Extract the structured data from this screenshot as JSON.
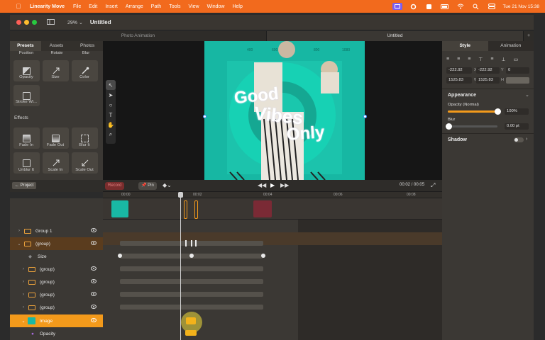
{
  "menubar": {
    "app_name": "Linearity Move",
    "items": [
      "File",
      "Edit",
      "Insert",
      "Arrange",
      "Path",
      "Tools",
      "View",
      "Window",
      "Help"
    ],
    "datetime": "Tue 21 Nov  15:38"
  },
  "window": {
    "zoom": "29%",
    "title": "Untitled",
    "tabs": [
      "Photo Animation",
      "Untitled"
    ]
  },
  "left_panel": {
    "tabs": [
      "Presets",
      "Assets",
      "Photos"
    ],
    "top_row_labels": [
      "Position",
      "Rotate",
      "Blur"
    ],
    "presets": [
      "Opacity",
      "Size",
      "Color",
      "Stroke Wi..."
    ],
    "effects_title": "Effects",
    "effects": [
      "Fade In",
      "Fade Out",
      "Blur It",
      "Unblur It",
      "Scale In",
      "Scale Out"
    ],
    "back_button": "Project"
  },
  "artboard": {
    "ruler_marks": [
      "400",
      "600",
      "800",
      "1080"
    ],
    "headline_lines": [
      "Good",
      "Vibes",
      "Only"
    ]
  },
  "right_panel": {
    "tabs": [
      "Style",
      "Animation"
    ],
    "x": "-222.92",
    "x_label": "X",
    "y": "-222.92",
    "y_label": "Y",
    "rotation": "0",
    "width": "1525.83",
    "width_label": "W",
    "height": "1525.83",
    "height_label": "H",
    "appearance_title": "Appearance",
    "opacity_label": "Opacity (Normal)",
    "opacity_value": "100%",
    "opacity_fraction": 1.0,
    "blur_label": "Blur",
    "blur_value": "0.00 pt",
    "shadow_title": "Shadow"
  },
  "transport": {
    "record_label": "Record",
    "pin_label": "Pin",
    "time": "00:02 / 00:05"
  },
  "ruler": {
    "labels": [
      "00:00",
      "00:02",
      "00:04",
      "00:06",
      "00:08"
    ]
  },
  "layers": [
    {
      "name": "Group 1",
      "expanded": false
    },
    {
      "name": "(group)",
      "expanded": true
    },
    {
      "name": "Size",
      "property": true
    },
    {
      "name": "(group)",
      "expanded": false
    },
    {
      "name": "(group)",
      "expanded": false
    },
    {
      "name": "(group)",
      "expanded": false
    },
    {
      "name": "(group)",
      "expanded": false
    },
    {
      "name": "Image",
      "selected": true
    },
    {
      "name": "Opacity",
      "property": true
    }
  ],
  "colors": {
    "menubar": "#f26a1d",
    "accent": "#f39a1b",
    "artboard": "#19b8a4"
  }
}
